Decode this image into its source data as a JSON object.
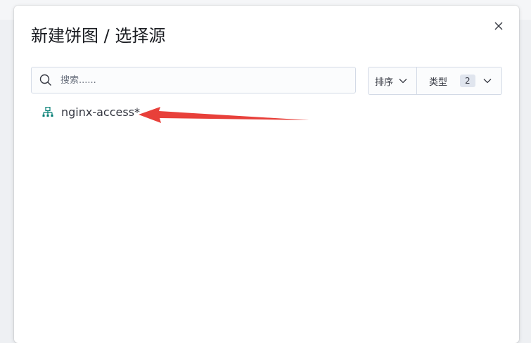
{
  "dialog": {
    "title": "新建饼图 / 选择源",
    "close_icon": "close-icon"
  },
  "search": {
    "placeholder": "搜索......",
    "value": "",
    "icon": "search-icon"
  },
  "filters": {
    "sort_label": "排序",
    "type_label": "类型",
    "type_count": "2",
    "chevron_icon": "chevron-down-icon"
  },
  "results": [
    {
      "label": "nginx-access*",
      "icon": "index-pattern-icon"
    }
  ],
  "annotation": {
    "arrow_color": "#e8403a"
  }
}
